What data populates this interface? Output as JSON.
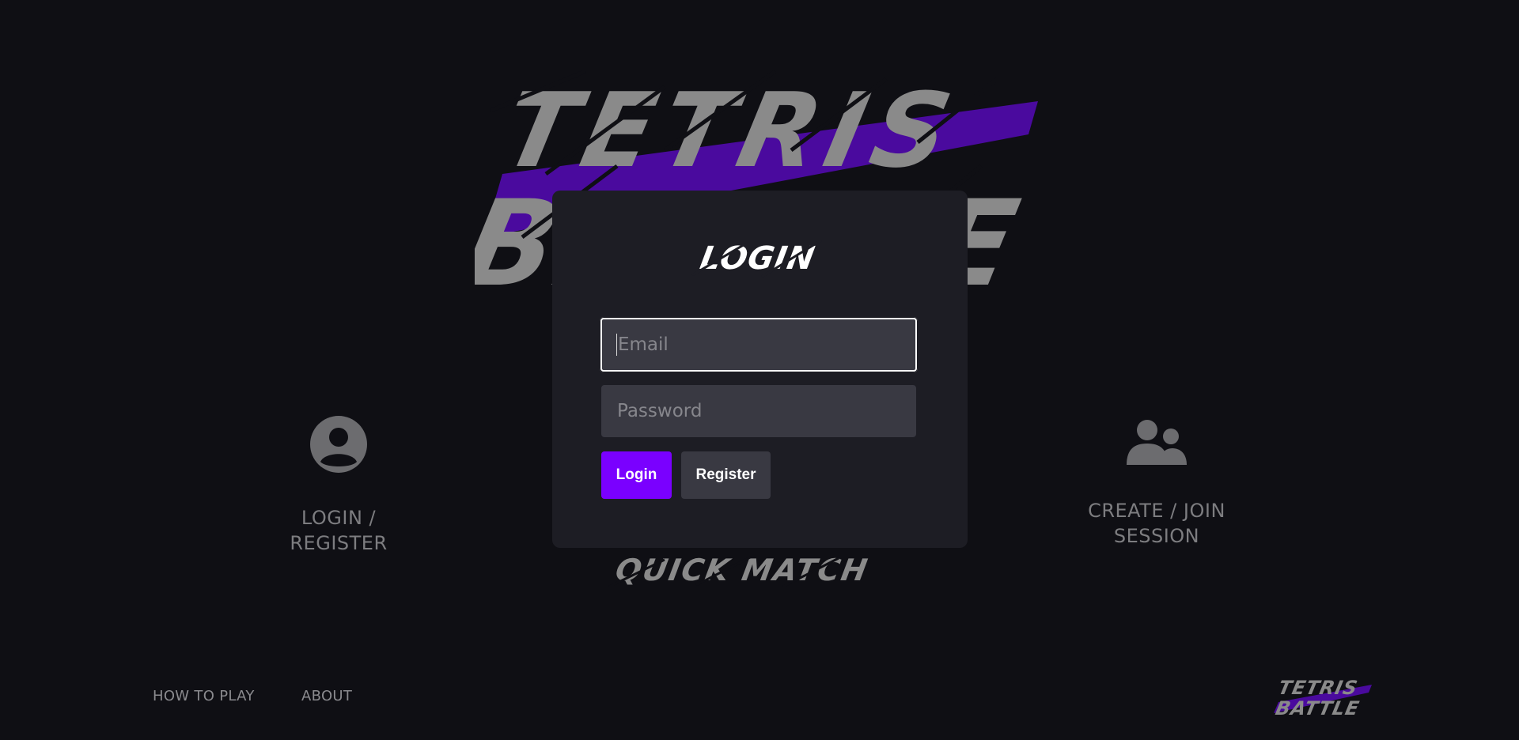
{
  "brand": {
    "logo_line1": "TETRIS",
    "logo_line2": "BATTLE",
    "accent_color": "#7a00ff"
  },
  "menu": {
    "login_register": {
      "label": "LOGIN / REGISTER",
      "icon": "user-circle-icon"
    },
    "create_join": {
      "label": "CREATE / JOIN SESSION",
      "icon": "users-icon"
    },
    "quick_match": {
      "label": "QUICK MATCH"
    }
  },
  "login_modal": {
    "title": "LOGIN",
    "email_placeholder": "Email",
    "password_placeholder": "Password",
    "login_label": "Login",
    "register_label": "Register"
  },
  "footer": {
    "how_to_play": "HOW TO PLAY",
    "about": "ABOUT"
  }
}
